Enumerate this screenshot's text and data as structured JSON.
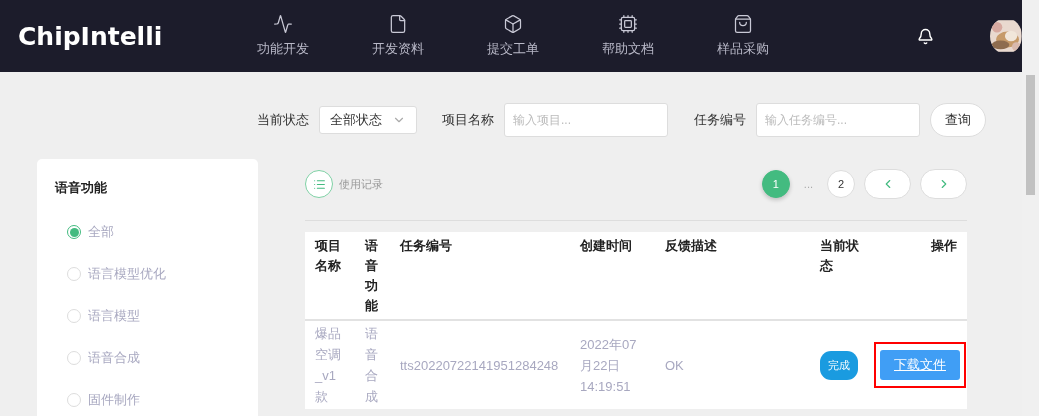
{
  "header": {
    "logo": "ChipIntelli",
    "nav": [
      {
        "label": "功能开发"
      },
      {
        "label": "开发资料"
      },
      {
        "label": "提交工单"
      },
      {
        "label": "帮助文档"
      },
      {
        "label": "样品采购"
      }
    ]
  },
  "filters": {
    "status": {
      "label": "当前状态",
      "value": "全部状态"
    },
    "project": {
      "label": "项目名称",
      "placeholder": "输入项目..."
    },
    "task": {
      "label": "任务编号",
      "placeholder": "输入任务编号..."
    },
    "query_button": "查询"
  },
  "sidebar": {
    "title": "语音功能",
    "options": [
      {
        "label": "全部",
        "selected": true
      },
      {
        "label": "语言模型优化",
        "selected": false
      },
      {
        "label": "语言模型",
        "selected": false
      },
      {
        "label": "语音合成",
        "selected": false
      },
      {
        "label": "固件制作",
        "selected": false
      }
    ]
  },
  "records_link": "使用记录",
  "pagination": {
    "ellipsis": "...",
    "pages": [
      {
        "label": "1",
        "selected": true
      },
      {
        "label": "2",
        "selected": false
      }
    ]
  },
  "table": {
    "columns": [
      "项目名称",
      "语音功能",
      "任务编号",
      "创建时间",
      "反馈描述",
      "当前状态",
      "操作"
    ],
    "rows": [
      {
        "cells": [
          "爆品空调_v1款",
          "语音合成",
          "tts20220722141951284248",
          "2022年07月22日 14:19:51",
          "OK"
        ],
        "status": "完成",
        "action": "下载文件",
        "highlighted": true
      }
    ]
  }
}
